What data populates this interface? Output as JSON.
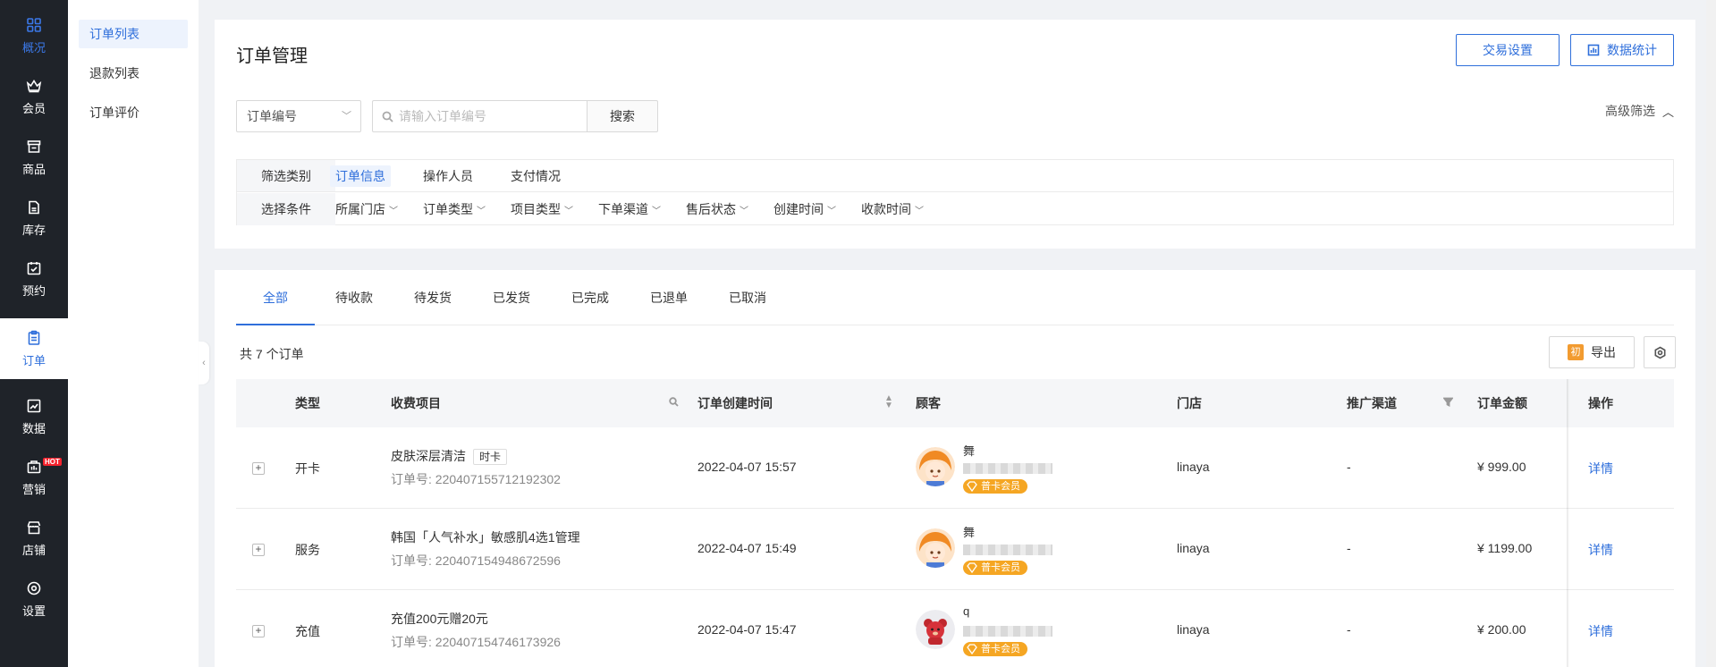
{
  "nav": {
    "items": [
      {
        "label": "概况",
        "icon": "grid-icon"
      },
      {
        "label": "会员",
        "icon": "crown-icon"
      },
      {
        "label": "商品",
        "icon": "shop-icon"
      },
      {
        "label": "库存",
        "icon": "inventory-icon"
      },
      {
        "label": "预约",
        "icon": "calendar-check-icon"
      },
      {
        "label": "订单",
        "icon": "clipboard-icon"
      },
      {
        "label": "数据",
        "icon": "chart-icon"
      },
      {
        "label": "营销",
        "icon": "marketing-icon"
      },
      {
        "label": "店铺",
        "icon": "store-icon"
      },
      {
        "label": "设置",
        "icon": "gear-icon"
      }
    ],
    "hot_badge": "HOT"
  },
  "subnav": {
    "items": [
      "订单列表",
      "退款列表",
      "订单评价"
    ]
  },
  "header": {
    "title": "订单管理",
    "trade_settings": "交易设置",
    "data_stats": "数据统计"
  },
  "search": {
    "field_select": "订单编号",
    "placeholder": "请输入订单编号",
    "button": "搜索",
    "advanced": "高级筛选"
  },
  "filters": {
    "category_label": "筛选类别",
    "categories": [
      "订单信息",
      "操作人员",
      "支付情况"
    ],
    "condition_label": "选择条件",
    "conditions": [
      "所属门店",
      "订单类型",
      "项目类型",
      "下单渠道",
      "售后状态",
      "创建时间",
      "收款时间"
    ]
  },
  "tabs": [
    "全部",
    "待收款",
    "待发货",
    "已发货",
    "已完成",
    "已退单",
    "已取消"
  ],
  "list": {
    "count_text": "共 7 个订单",
    "export": "导出",
    "export_icon_text": "初"
  },
  "table": {
    "headers": {
      "type": "类型",
      "item": "收费项目",
      "time": "订单创建时间",
      "customer": "顾客",
      "store": "门店",
      "channel": "推广渠道",
      "amount": "订单金额",
      "action": "操作"
    },
    "rows": [
      {
        "type": "开卡",
        "item": "皮肤深层清洁",
        "tag": "时卡",
        "order_no": "订单号: 220407155712192302",
        "time": "2022-04-07 15:57",
        "customer": "舞",
        "badge": "普卡会员",
        "store": "linaya",
        "channel": "-",
        "amount": "¥ 999.00",
        "action": "详情"
      },
      {
        "type": "服务",
        "item": "韩国「人气补水」敏感肌4选1管理",
        "tag": "",
        "order_no": "订单号: 220407154948672596",
        "time": "2022-04-07 15:49",
        "customer": "舞",
        "badge": "普卡会员",
        "store": "linaya",
        "channel": "-",
        "amount": "¥ 1199.00",
        "action": "详情"
      },
      {
        "type": "充值",
        "item": "充值200元赠20元",
        "tag": "",
        "order_no": "订单号: 220407154746173926",
        "time": "2022-04-07 15:47",
        "customer": "q",
        "badge": "普卡会员",
        "store": "linaya",
        "channel": "-",
        "amount": "¥ 200.00",
        "action": "详情"
      }
    ]
  },
  "colors": {
    "primary": "#2f6fdb",
    "nav_bg": "#1f2329",
    "badge": "#f5a623",
    "export_icon": "#f29b30"
  }
}
